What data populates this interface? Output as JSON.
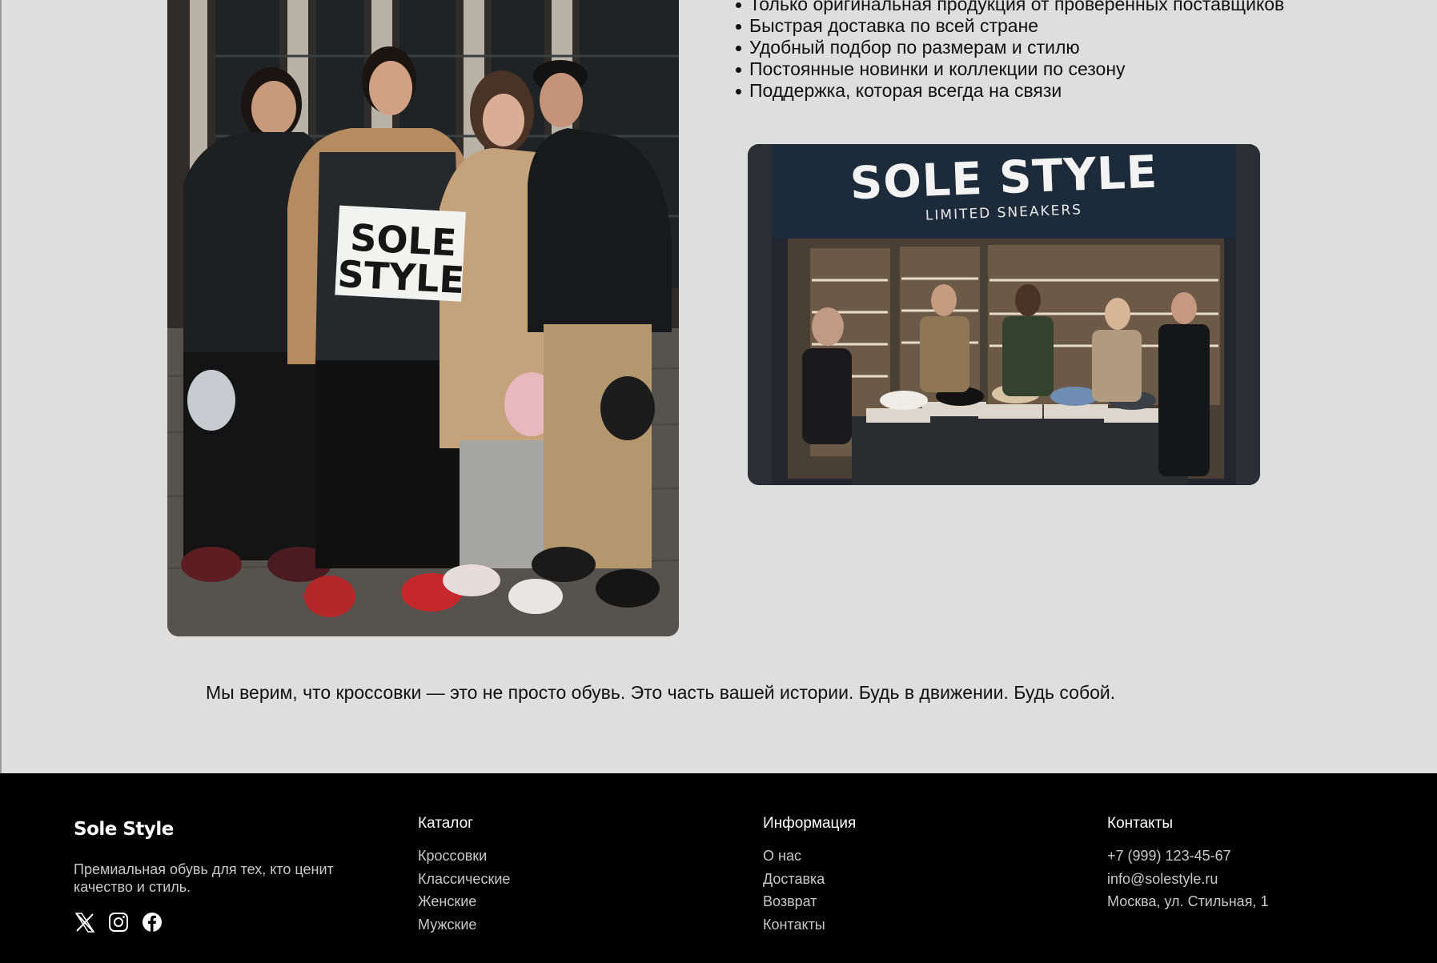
{
  "features": [
    "Только оригинальная продукция от проверенных поставщиков",
    "Быстрая доставка по всей стране",
    "Удобный подбор по размерам и стилю",
    "Постоянные новинки и коллекции по сезону",
    "Поддержка, которая всегда на связи"
  ],
  "group_photo": {
    "sign_line1": "SOLE",
    "sign_line2": "STYLE"
  },
  "store_photo": {
    "sign_title": "SOLE STYLE",
    "sign_subtitle": "LIMITED SNEAKERS"
  },
  "tagline": "Мы верим, что кроссовки — это не просто обувь. Это часть вашей истории. Будь в движении. Будь собой.",
  "footer": {
    "brand": "Sole Style",
    "description": "Премиальная обувь для тех, кто ценит качество и стиль.",
    "social": [
      "x-icon",
      "instagram-icon",
      "facebook-icon"
    ],
    "catalog": {
      "title": "Каталог",
      "items": [
        "Кроссовки",
        "Классические",
        "Женские",
        "Мужские"
      ]
    },
    "info": {
      "title": "Информация",
      "items": [
        "О нас",
        "Доставка",
        "Возврат",
        "Контакты"
      ]
    },
    "contacts": {
      "title": "Контакты",
      "phone": "+7 (999) 123-45-67",
      "email": "info@solestyle.ru",
      "address": "Москва, ул. Стильная, 1"
    }
  },
  "colors": {
    "page_background": "#dedede",
    "footer_background": "#000000",
    "footer_text": "#ffffff",
    "footer_muted": "#c9c9c9"
  }
}
